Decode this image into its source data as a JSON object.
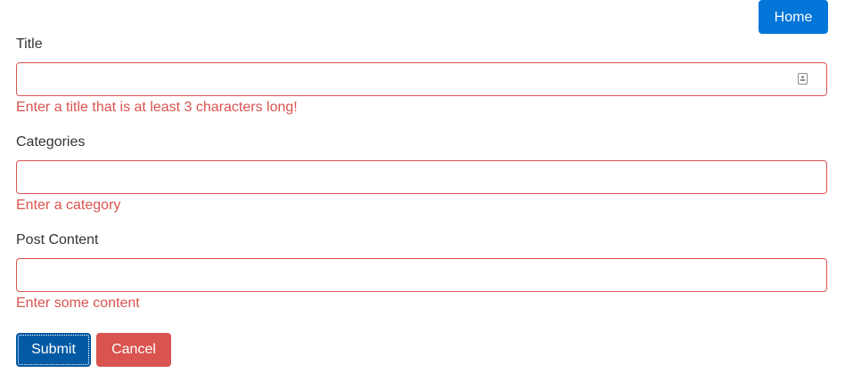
{
  "nav": {
    "home_label": "Home"
  },
  "form": {
    "title": {
      "label": "Title",
      "value": "",
      "error": "Enter a title that is at least 3 characters long!",
      "icon": "contact-card-icon"
    },
    "categories": {
      "label": "Categories",
      "value": "",
      "error": "Enter a category"
    },
    "content": {
      "label": "Post Content",
      "value": "",
      "error": "Enter some content"
    },
    "submit_label": "Submit",
    "cancel_label": "Cancel"
  },
  "colors": {
    "primary": "#0275d8",
    "primary_active": "#025aa5",
    "danger": "#d9534f",
    "text": "#333333"
  }
}
